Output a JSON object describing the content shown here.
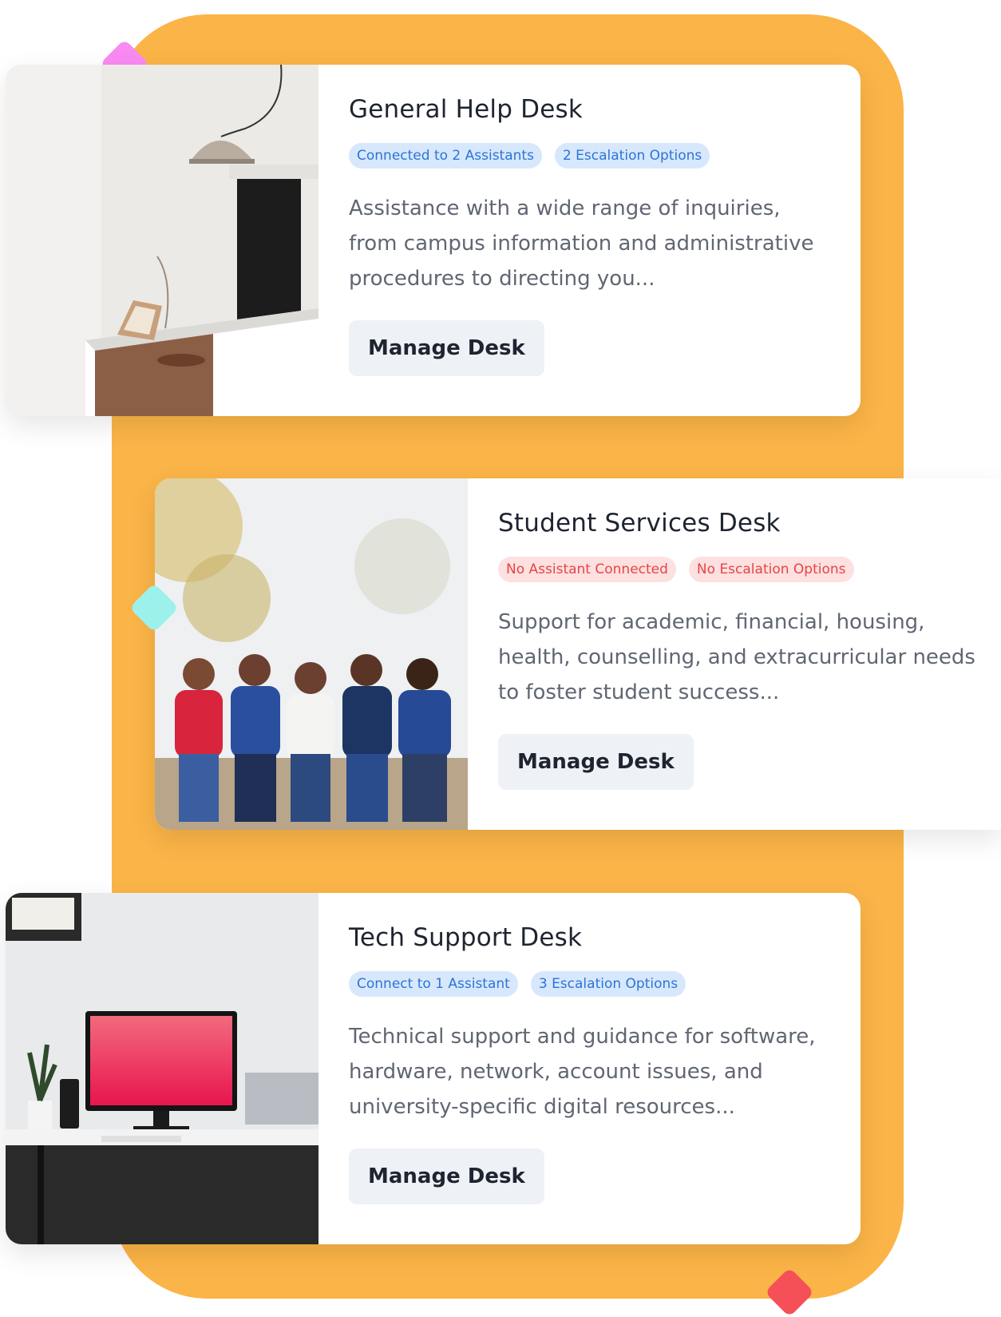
{
  "desks": [
    {
      "title": "General Help Desk",
      "tags": [
        "Connected to 2 Assistants",
        "2 Escalation Options"
      ],
      "description": "Assistance with a wide range of inquiries, from campus information and administrative procedures to directing you...",
      "button": "Manage Desk"
    },
    {
      "title": "Student Services Desk",
      "tags": [
        "No Assistant Connected",
        "No Escalation Options"
      ],
      "description": "Support for academic, financial, housing, health, counselling, and extracurricular needs to foster student success...",
      "button": "Manage Desk"
    },
    {
      "title": "Tech Support Desk",
      "tags": [
        "Connect to 1 Assistant",
        "3 Escalation Options"
      ],
      "description": "Technical support and guidance for software, hardware, network, account issues, and university-specific digital resources...",
      "button": "Manage Desk"
    }
  ],
  "colors": {
    "backdrop": "#fbb447",
    "tag_blue_bg": "#d7e8fc",
    "tag_blue_text": "#2d74d6",
    "tag_red_bg": "#fde0e0",
    "tag_red_text": "#e64545"
  }
}
